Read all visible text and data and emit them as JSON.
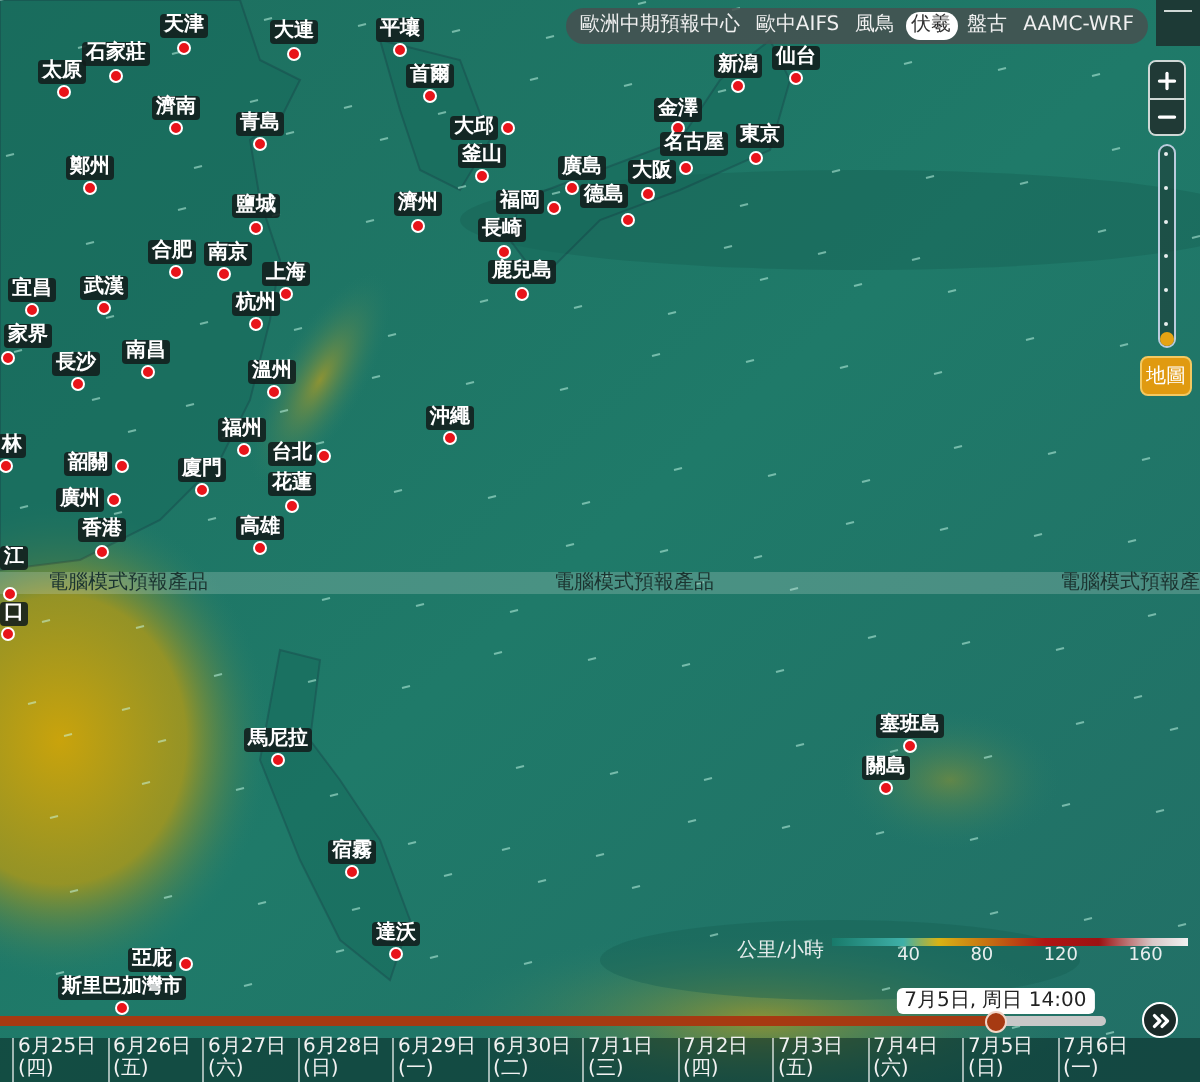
{
  "model_selector": {
    "options": [
      {
        "label": "歐洲中期預報中心",
        "selected": false
      },
      {
        "label": "歐中AIFS",
        "selected": false
      },
      {
        "label": "風鳥",
        "selected": false
      },
      {
        "label": "伏羲",
        "selected": true
      },
      {
        "label": "盤古",
        "selected": false
      },
      {
        "label": "AAMC-WRF",
        "selected": false
      }
    ]
  },
  "zoom_slider": {
    "level": 0
  },
  "map_button": "地圖",
  "banner": [
    "電腦模式預報產品",
    "電腦模式預報產品",
    "電腦模式預報產"
  ],
  "cities": [
    {
      "name": "天津"
    },
    {
      "name": "大連"
    },
    {
      "name": "平壤"
    },
    {
      "name": "石家莊"
    },
    {
      "name": "太原"
    },
    {
      "name": "首爾"
    },
    {
      "name": "濟南"
    },
    {
      "name": "青島"
    },
    {
      "name": "大邱"
    },
    {
      "name": "釜山"
    },
    {
      "name": "鄭州"
    },
    {
      "name": "廣島"
    },
    {
      "name": "新潟"
    },
    {
      "name": "仙台"
    },
    {
      "name": "金澤"
    },
    {
      "name": "東京"
    },
    {
      "name": "名古屋"
    },
    {
      "name": "大阪"
    },
    {
      "name": "德島"
    },
    {
      "name": "鹽城"
    },
    {
      "name": "濟州"
    },
    {
      "name": "福岡"
    },
    {
      "name": "長崎"
    },
    {
      "name": "鹿兒島"
    },
    {
      "name": "合肥"
    },
    {
      "name": "南京"
    },
    {
      "name": "上海"
    },
    {
      "name": "宜昌"
    },
    {
      "name": "武漢"
    },
    {
      "name": "杭州"
    },
    {
      "name": "家界"
    },
    {
      "name": "長沙"
    },
    {
      "name": "南昌"
    },
    {
      "name": "溫州"
    },
    {
      "name": "沖繩"
    },
    {
      "name": "福州"
    },
    {
      "name": "林"
    },
    {
      "name": "台北"
    },
    {
      "name": "韶關"
    },
    {
      "name": "廈門"
    },
    {
      "name": "花蓮"
    },
    {
      "name": "廣州"
    },
    {
      "name": "香港"
    },
    {
      "name": "高雄"
    },
    {
      "name": "江"
    },
    {
      "name": "口"
    },
    {
      "name": "馬尼拉"
    },
    {
      "name": "宿霧"
    },
    {
      "name": "達沃"
    },
    {
      "name": "亞庇"
    },
    {
      "name": "斯里巴加灣市"
    },
    {
      "name": "塞班島"
    },
    {
      "name": "關島"
    }
  ],
  "legend": {
    "unit": "公里/小時",
    "ticks": [
      "40",
      "80",
      "120",
      "160"
    ]
  },
  "timeline": {
    "level": 0.9,
    "tooltip": "7月5日, 周日 14:00",
    "days": [
      "6月25日 (四)",
      "6月26日 (五)",
      "6月27日 (六)",
      "6月28日 (日)",
      "6月29日 (一)",
      "6月30日 (二)",
      "7月1日 (三)",
      "7月2日 (四)",
      "7月3日 (五)",
      "7月4日 (六)",
      "7月5日 (日)",
      "7月6日 (一)"
    ]
  }
}
